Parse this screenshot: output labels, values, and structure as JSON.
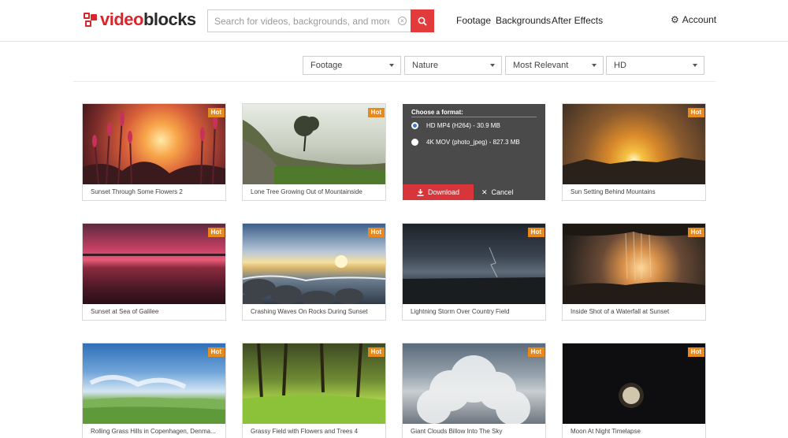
{
  "header": {
    "logo_text_left": "video",
    "logo_text_right": "blocks",
    "search_placeholder": "Search for videos, backgrounds, and more...",
    "nav": [
      "Footage",
      "Backgrounds",
      "After Effects"
    ],
    "account_label": "Account"
  },
  "filters": {
    "type": "Footage",
    "category": "Nature",
    "sort": "Most Relevant",
    "resolution": "HD"
  },
  "badge": "Hot",
  "cards": [
    {
      "caption": "Sunset Through Some Flowers 2"
    },
    {
      "caption": "Lone Tree Growing Out of Mountainside"
    },
    {
      "caption": ""
    },
    {
      "caption": "Sun Setting Behind Mountains"
    },
    {
      "caption": "Sunset at Sea of Galilee"
    },
    {
      "caption": "Crashing Waves On Rocks During Sunset"
    },
    {
      "caption": "Lightning Storm Over Country Field"
    },
    {
      "caption": "Inside Shot of a Waterfall at Sunset"
    },
    {
      "caption": "Rolling Grass Hills in Copenhagen, Denma..."
    },
    {
      "caption": "Grassy Field with Flowers and Trees 4"
    },
    {
      "caption": "Giant Clouds Billow Into The Sky"
    },
    {
      "caption": "Moon At Night Timelapse"
    }
  ],
  "chooser": {
    "title": "Choose a format:",
    "options": [
      {
        "label": "HD MP4 (H264) - 30.9 MB",
        "selected": true
      },
      {
        "label": "4K MOV (photo_jpeg) - 827.3 MB",
        "selected": false
      }
    ],
    "download_label": "Download",
    "cancel_label": "Cancel"
  },
  "colors": {
    "brand_red": "#d8262d",
    "hot_badge": "#e8891e",
    "chooser_bg": "#4a4a4a"
  }
}
